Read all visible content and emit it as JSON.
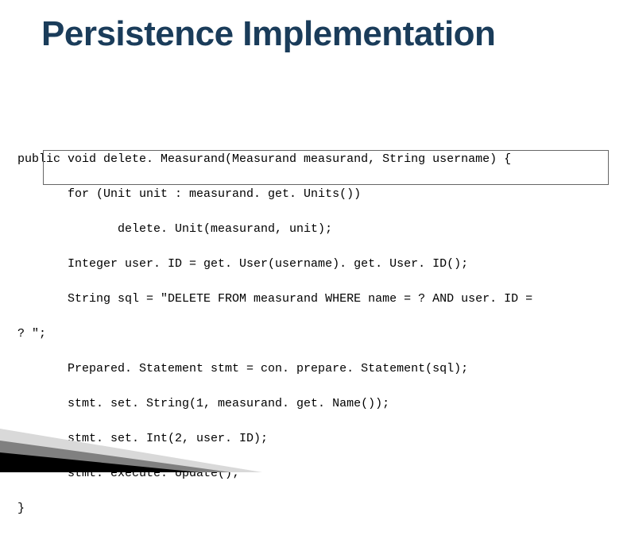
{
  "title": "Persistence Implementation",
  "code": {
    "l1": "public void delete. Measurand(Measurand measurand, String username) {",
    "l2": "       for (Unit unit : measurand. get. Units())",
    "l3": "              delete. Unit(measurand, unit);",
    "l4": "       Integer user. ID = get. User(username). get. User. ID();",
    "l5": "       String sql = \"DELETE FROM measurand WHERE name = ? AND user. ID =",
    "l6": "? \";",
    "l7": "       Prepared. Statement stmt = con. prepare. Statement(sql);",
    "l8": "       stmt. set. String(1, measurand. get. Name());",
    "l9": "       stmt. set. Int(2, user. ID);",
    "l10": "       stmt. execute. Update();",
    "l11": "}"
  }
}
